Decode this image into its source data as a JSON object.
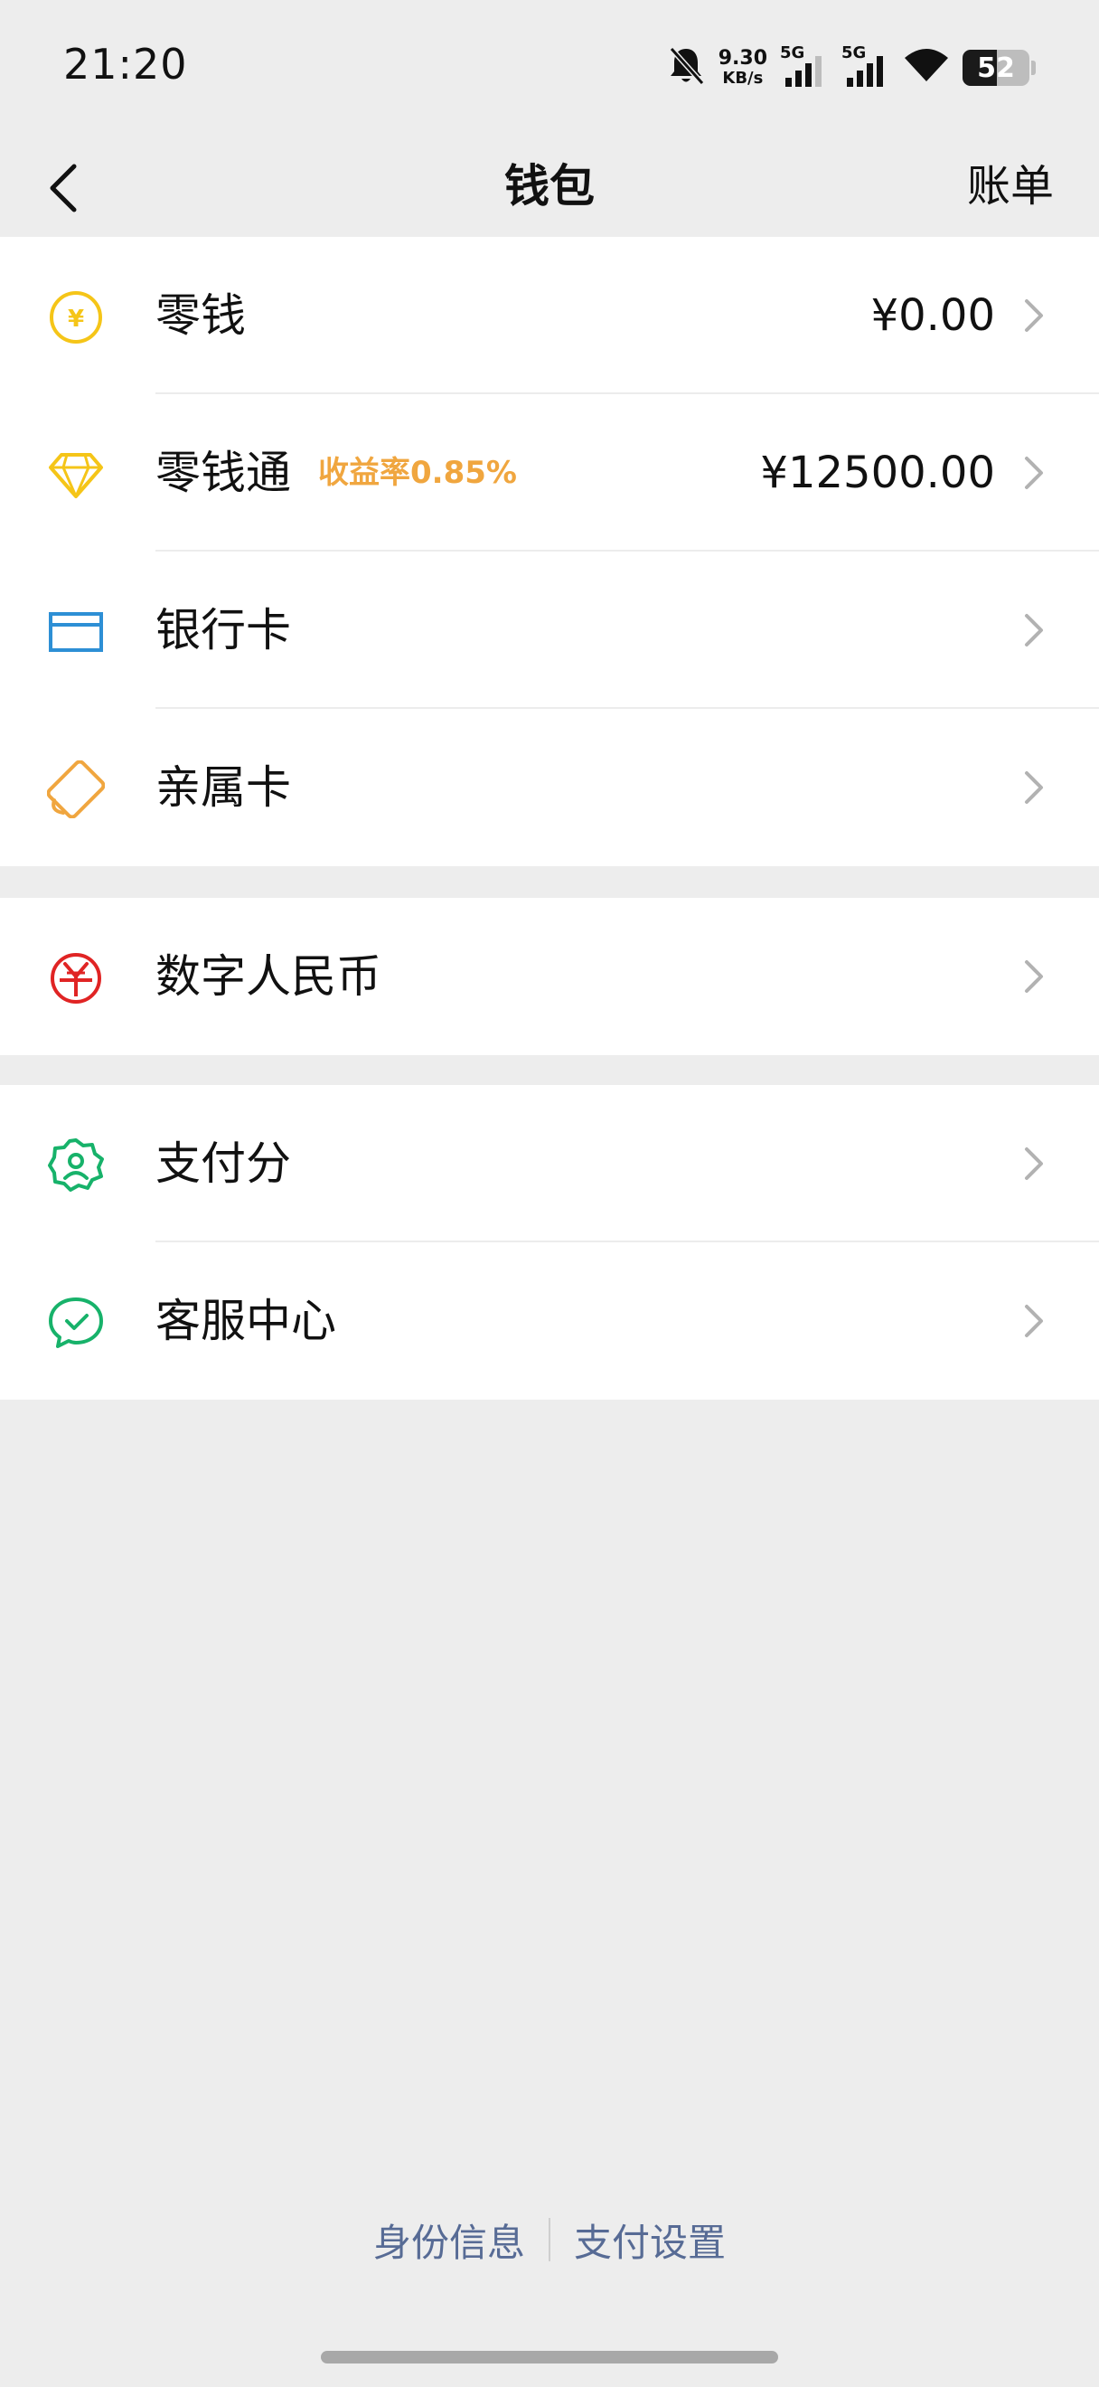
{
  "status_bar": {
    "time": "21:20",
    "net_speed_value": "9.30",
    "net_speed_unit": "KB/s",
    "sim1_label": "5G",
    "sim2_label": "5G",
    "battery": "52"
  },
  "nav": {
    "title": "钱包",
    "right_label": "账单"
  },
  "section1": {
    "items": [
      {
        "label": "零钱",
        "value": "¥0.00",
        "icon": "yuan-coin-icon"
      },
      {
        "label": "零钱通",
        "badge": "收益率0.85%",
        "value": "¥12500.00",
        "icon": "diamond-icon"
      },
      {
        "label": "银行卡",
        "icon": "bank-card-icon"
      },
      {
        "label": "亲属卡",
        "icon": "family-card-icon"
      }
    ]
  },
  "section2": {
    "items": [
      {
        "label": "数字人民币",
        "icon": "digital-rmb-icon"
      }
    ]
  },
  "section3": {
    "items": [
      {
        "label": "支付分",
        "icon": "pay-score-icon"
      },
      {
        "label": "客服中心",
        "icon": "customer-service-icon"
      }
    ]
  },
  "footer": {
    "link1": "身份信息",
    "link2": "支付设置"
  },
  "colors": {
    "yellow": "#f5c518",
    "blue": "#2d8fd5",
    "orange": "#f0a63f",
    "red": "#e02424",
    "green": "#17b26a",
    "link": "#576b95"
  }
}
